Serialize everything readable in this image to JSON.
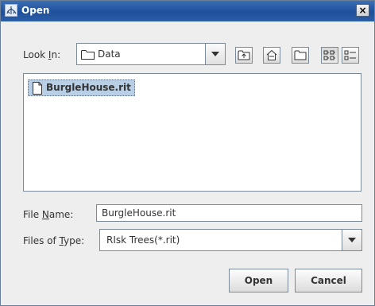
{
  "window": {
    "title": "Open",
    "close_glyph": "×",
    "app_icon": "tree-icon"
  },
  "look_in": {
    "label_before": "Look ",
    "label_mnemonic": "I",
    "label_after": "n:",
    "selected": "Data",
    "icon": "folder-icon"
  },
  "toolbar": {
    "buttons": [
      {
        "name": "up-one-level-button",
        "icon": "folder-up-icon"
      },
      {
        "name": "home-button",
        "icon": "home-icon"
      },
      {
        "name": "new-folder-button",
        "icon": "new-folder-icon"
      },
      {
        "name": "list-view-button",
        "icon": "list-view-icon",
        "pressed": true
      },
      {
        "name": "details-view-button",
        "icon": "details-view-icon"
      }
    ]
  },
  "files": [
    {
      "name": "BurgleHouse.rit",
      "icon": "file-icon",
      "selected": true
    }
  ],
  "file_name": {
    "label_before": "File ",
    "label_mnemonic": "N",
    "label_after": "ame:",
    "value": "BurgleHouse.rit"
  },
  "files_of_type": {
    "label_before": "Files of ",
    "label_mnemonic": "T",
    "label_after": "ype:",
    "selected": "RIsk Trees(*.rit)"
  },
  "buttons": {
    "open": "Open",
    "cancel": "Cancel"
  },
  "colors": {
    "titlebar": "#2c5fa8",
    "selection": "#b8cfe5",
    "border": "#7a8a99"
  }
}
